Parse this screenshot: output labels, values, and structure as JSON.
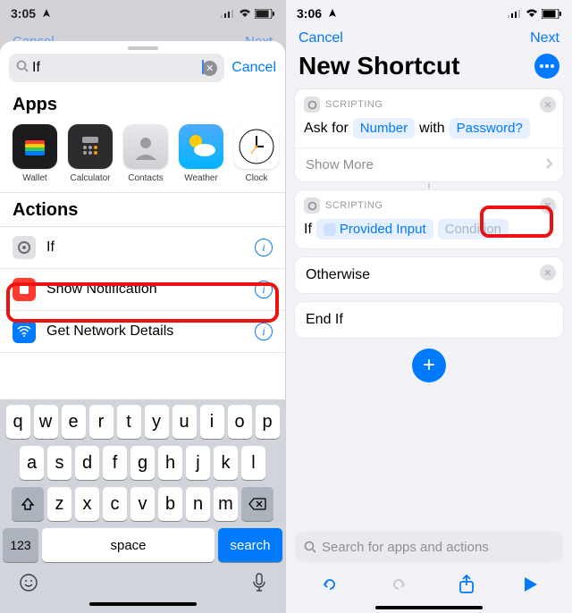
{
  "left": {
    "status": {
      "time": "3:05"
    },
    "dimNav": {
      "cancel": "Cancel",
      "next": "Next"
    },
    "search": {
      "query": "If",
      "cancel": "Cancel"
    },
    "appsTitle": "Apps",
    "apps": [
      {
        "name": "Wallet"
      },
      {
        "name": "Calculator"
      },
      {
        "name": "Contacts"
      },
      {
        "name": "Weather"
      },
      {
        "name": "Clock"
      }
    ],
    "actionsTitle": "Actions",
    "actions": [
      {
        "label": "If"
      },
      {
        "label": "Show Notification"
      },
      {
        "label": "Get Network Details"
      }
    ],
    "keyboard": {
      "row1": [
        "q",
        "w",
        "e",
        "r",
        "t",
        "y",
        "u",
        "i",
        "o",
        "p"
      ],
      "row2": [
        "a",
        "s",
        "d",
        "f",
        "g",
        "h",
        "j",
        "k",
        "l"
      ],
      "row3": [
        "z",
        "x",
        "c",
        "v",
        "b",
        "n",
        "m"
      ],
      "numKey": "123",
      "space": "space",
      "search": "search"
    }
  },
  "right": {
    "status": {
      "time": "3:06"
    },
    "nav": {
      "cancel": "Cancel",
      "next": "Next"
    },
    "title": "New Shortcut",
    "scriptingLabel": "SCRIPTING",
    "card1": {
      "prefix": "Ask for",
      "token1": "Number",
      "mid": "with",
      "token2": "Password?",
      "showMore": "Show More"
    },
    "card2": {
      "prefix": "If",
      "token1": "Provided Input",
      "token2": "Condition"
    },
    "otherwise": "Otherwise",
    "endif": "End If",
    "searchPlaceholder": "Search for apps and actions"
  }
}
